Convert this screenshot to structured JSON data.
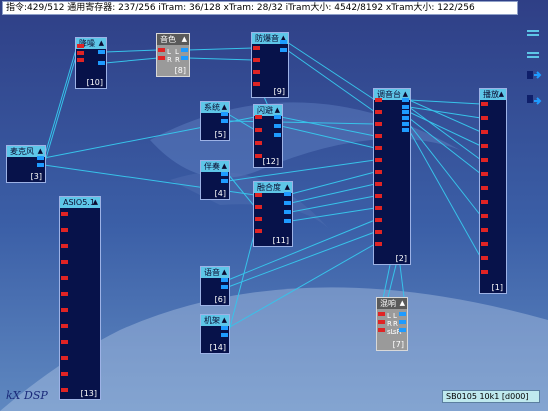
{
  "titlebar": {
    "text": "指令:429/512 通用寄存器: 237/256 iTram: 36/128 xTram: 28/32 iTram大小: 4542/8192 xTram大小: 122/256"
  },
  "side_icons": [
    "menu-lines-icon",
    "menu-lines-icon",
    "speaker-in-icon",
    "speaker-out-icon"
  ],
  "modules": {
    "jiangzao": {
      "title": "降噪",
      "num": "[10]"
    },
    "yinse": {
      "title": "音色",
      "num": "[8]",
      "pin_labels": [
        "L",
        "L",
        "R",
        "R"
      ]
    },
    "fangbao": {
      "title": "防爆音",
      "num": "[9]"
    },
    "tiaoyin": {
      "title": "调音台",
      "num": "[2]"
    },
    "bofang": {
      "title": "播放",
      "num": "[1]"
    },
    "xitong": {
      "title": "系统",
      "num": "[5]"
    },
    "shanbi": {
      "title": "闪避",
      "num": "[12]"
    },
    "maikefeng": {
      "title": "麦克风",
      "num": "[3]"
    },
    "banzou": {
      "title": "伴奏",
      "num": "[4]"
    },
    "ronghedu": {
      "title": "融合度",
      "num": "[11]"
    },
    "asio": {
      "title": "ASIO5.1",
      "num": "[13]"
    },
    "yugou": {
      "title": "语音",
      "num": "[6]"
    },
    "jijia": {
      "title": "机架",
      "num": "[14]"
    },
    "hunxiang": {
      "title": "混响",
      "num": "[7]",
      "pin_labels": [
        "L",
        "L",
        "R",
        "R",
        "sL",
        "sR"
      ]
    }
  },
  "logo": {
    "text": "kX DSP"
  },
  "status": {
    "text": "SB0105 10k1 [d000]"
  }
}
